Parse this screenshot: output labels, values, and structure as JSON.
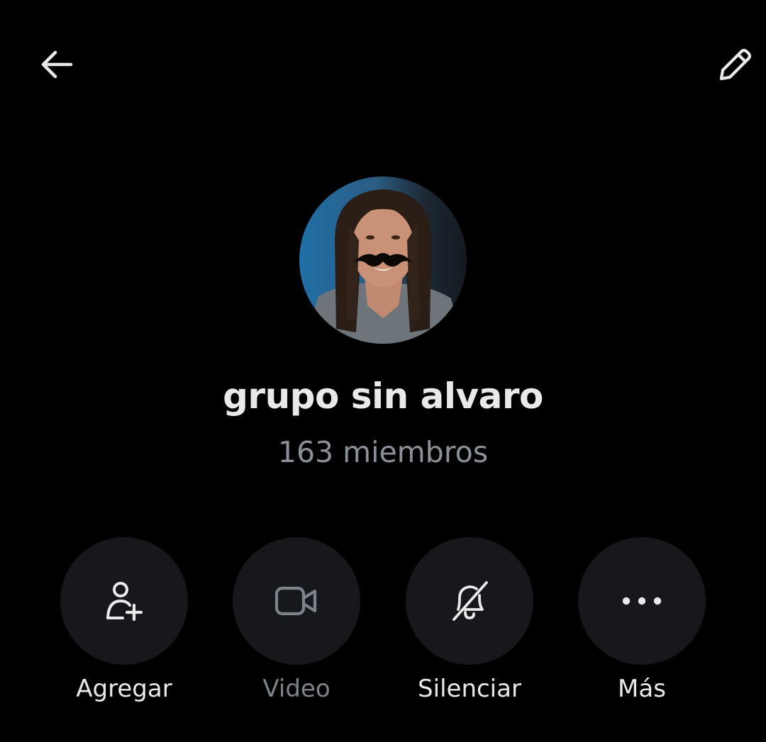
{
  "header": {
    "back_icon": "arrow-left-icon",
    "edit_icon": "pencil-icon"
  },
  "group": {
    "name": "grupo sin alvaro",
    "members": "163 miembros"
  },
  "actions": [
    {
      "label": "Agregar",
      "icon": "add-person-icon",
      "enabled": true
    },
    {
      "label": "Video",
      "icon": "video-camera-icon",
      "enabled": false
    },
    {
      "label": "Silenciar",
      "icon": "bell-slash-icon",
      "enabled": true
    },
    {
      "label": "Más",
      "icon": "more-dots-icon",
      "enabled": true
    }
  ],
  "colors": {
    "background": "#000000",
    "primary_text": "#e7e9ea",
    "secondary_text": "#8b9199",
    "button_fill": "#16181c",
    "disabled_text": "#7d838a"
  }
}
